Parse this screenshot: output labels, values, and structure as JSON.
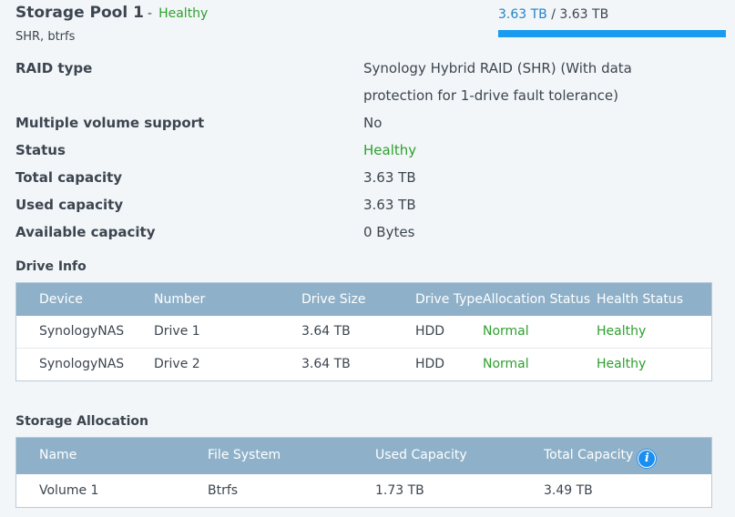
{
  "pool": {
    "title": "Storage Pool 1",
    "dash": "-",
    "health": "Healthy",
    "subtitle": "SHR, btrfs",
    "usage_used": "3.63 TB",
    "usage_sep": " / ",
    "usage_total": "3.63 TB",
    "usage_fraction": 1.0
  },
  "properties": [
    {
      "label": "RAID type",
      "value": "Synology Hybrid RAID (SHR) (With data protection for 1-drive fault tolerance)"
    },
    {
      "label": "Multiple volume support",
      "value": "No"
    },
    {
      "label": "Status",
      "value": "Healthy"
    },
    {
      "label": "Total capacity",
      "value": "3.63 TB"
    },
    {
      "label": "Used capacity",
      "value": "3.63 TB"
    },
    {
      "label": "Available capacity",
      "value": "0 Bytes"
    }
  ],
  "drive_info": {
    "title": "Drive Info",
    "columns": [
      "Device",
      "Number",
      "Drive Size",
      "Drive Type",
      "Allocation Status",
      "Health Status"
    ],
    "rows": [
      [
        "SynologyNAS",
        "Drive 1",
        "3.64 TB",
        "HDD",
        "Normal",
        "Healthy"
      ],
      [
        "SynologyNAS",
        "Drive 2",
        "3.64 TB",
        "HDD",
        "Normal",
        "Healthy"
      ]
    ]
  },
  "storage_allocation": {
    "title": "Storage Allocation",
    "columns": [
      "Name",
      "File System",
      "Used Capacity",
      "Total Capacity"
    ],
    "info_icon": "info-icon",
    "info_glyph": "i",
    "rows": [
      [
        "Volume 1",
        "Btrfs",
        "1.73 TB",
        "3.49 TB"
      ]
    ]
  },
  "colors": {
    "healthy": "#2ea02e",
    "accent": "#1a9bf0",
    "table_header": "#8eb1c9"
  }
}
